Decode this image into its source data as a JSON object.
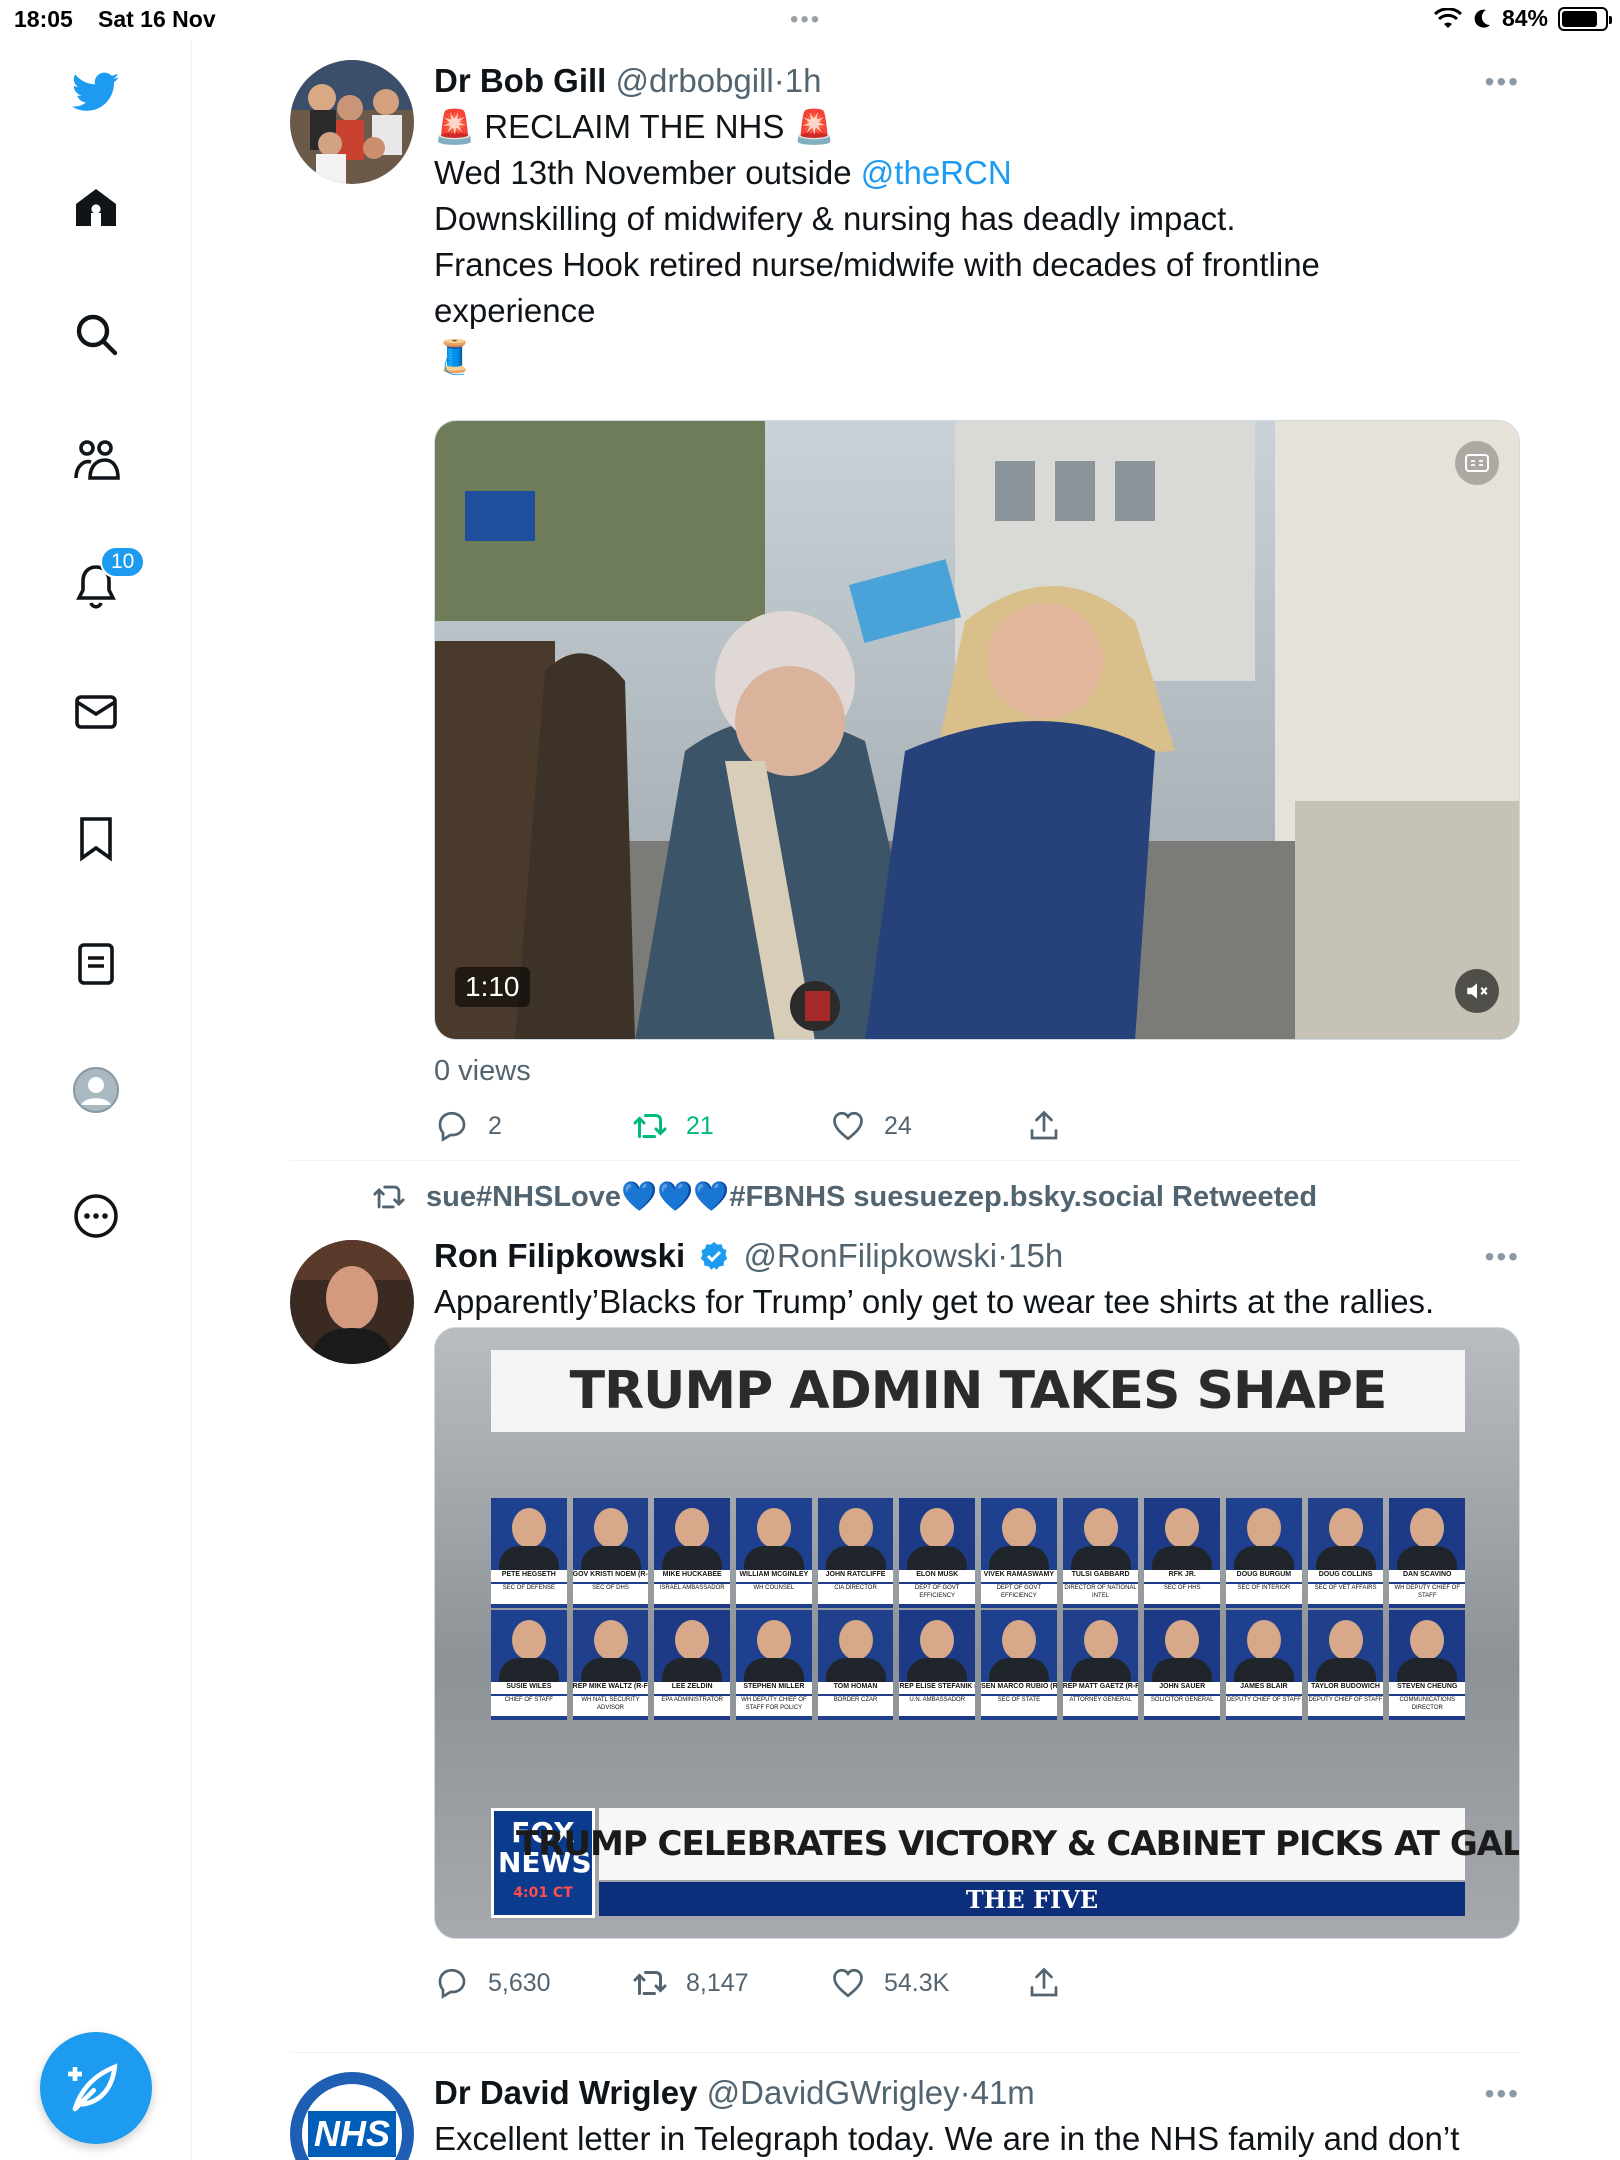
{
  "status_bar": {
    "time": "18:05",
    "date": "Sat 16 Nov",
    "battery": "84%",
    "battery_level": 0.84
  },
  "sidebar": {
    "items": [
      "twitter-logo",
      "home-icon",
      "search-icon",
      "communities-icon",
      "notifications-icon",
      "messages-icon",
      "bookmarks-icon",
      "lists-icon",
      "profile-icon",
      "more-icon"
    ],
    "notification_badge": "10",
    "compose": "compose-icon"
  },
  "tweets": [
    {
      "name": "Dr Bob Gill",
      "handle": "@drbobgill",
      "sep": "·",
      "time": "1h",
      "lines": [
        "🚨 RECLAIM THE NHS 🚨",
        "Wed 13th November outside ",
        "Downskilling of midwifery & nursing has deadly impact.",
        "Frances Hook retired nurse/midwife with decades of frontline",
        "experience",
        "🧵"
      ],
      "mention": "@theRCN",
      "video_duration": "1:10",
      "views": "0 views",
      "replies": "2",
      "retweets": "21",
      "likes": "24"
    },
    {
      "retweeted_by": "sue#NHSLove💙💙💙#FBNHS suesuezep.bsky.social Retweeted",
      "name": "Ron Filipkowski",
      "handle": "@RonFilipkowski",
      "sep": "·",
      "time": "15h",
      "text": "Apparently’Blacks for Trump’ only get to wear tee shirts at the rallies.",
      "image": {
        "headline": "TRUMP ADMIN TAKES SHAPE",
        "row1": [
          {
            "name": "PETE HEGSETH",
            "role": "SEC OF DEFENSE"
          },
          {
            "name": "GOV KRISTI NOEM (R-SD)",
            "role": "SEC OF DHS"
          },
          {
            "name": "MIKE HUCKABEE",
            "role": "ISRAEL AMBASSADOR"
          },
          {
            "name": "WILLIAM MCGINLEY",
            "role": "WH COUNSEL"
          },
          {
            "name": "JOHN RATCLIFFE",
            "role": "CIA DIRECTOR"
          },
          {
            "name": "ELON MUSK",
            "role": "DEPT OF GOVT EFFICIENCY"
          },
          {
            "name": "VIVEK RAMASWAMY",
            "role": "DEPT OF GOVT EFFICIENCY"
          },
          {
            "name": "TULSI GABBARD",
            "role": "DIRECTOR OF NATIONAL INTEL"
          },
          {
            "name": "RFK JR.",
            "role": "SEC OF HHS"
          },
          {
            "name": "DOUG BURGUM",
            "role": "SEC OF INTERIOR"
          },
          {
            "name": "DOUG COLLINS",
            "role": "SEC OF VET AFFAIRS"
          },
          {
            "name": "DAN SCAVINO",
            "role": "WH DEPUTY CHIEF OF STAFF"
          }
        ],
        "row2": [
          {
            "name": "SUSIE WILES",
            "role": "CHIEF OF STAFF"
          },
          {
            "name": "REP MIKE WALTZ (R-FL)",
            "role": "WH NATL SECURITY ADVISOR"
          },
          {
            "name": "LEE ZELDIN",
            "role": "EPA ADMINISTRATOR"
          },
          {
            "name": "STEPHEN MILLER",
            "role": "WH DEPUTY CHIEF OF STAFF FOR POLICY"
          },
          {
            "name": "TOM HOMAN",
            "role": "BORDER CZAR"
          },
          {
            "name": "REP ELISE STEFANIK (R-NY)",
            "role": "U.N. AMBASSADOR"
          },
          {
            "name": "SEN MARCO RUBIO (R-FL)",
            "role": "SEC OF STATE"
          },
          {
            "name": "REP MATT GAETZ (R-FL)",
            "role": "ATTORNEY GENERAL"
          },
          {
            "name": "JOHN SAUER",
            "role": "SOLICITOR GENERAL"
          },
          {
            "name": "JAMES BLAIR",
            "role": "DEPUTY CHIEF OF STAFF"
          },
          {
            "name": "TAYLOR BUDOWICH",
            "role": "DEPUTY CHIEF OF STAFF"
          },
          {
            "name": "STEVEN CHEUNG",
            "role": "COMMUNICATIONS DIRECTOR"
          }
        ],
        "network": "FOX NEWS",
        "clock": "4:01 CT",
        "lower_third": "TRUMP CELEBRATES VICTORY & CABINET PICKS AT GALA",
        "show": "THE FIVE"
      },
      "replies": "5,630",
      "retweets": "8,147",
      "likes": "54.3K"
    },
    {
      "name": "Dr David Wrigley",
      "handle": "@DavidGWrigley",
      "sep": "·",
      "time": "41m",
      "text": "Excellent letter in Telegraph today. We are in the NHS family and don’t",
      "avatar_text": "NHS"
    }
  ],
  "colors": {
    "accent": "#1d9bf0",
    "retweet_green": "#00ba7c",
    "muted": "#536471"
  }
}
